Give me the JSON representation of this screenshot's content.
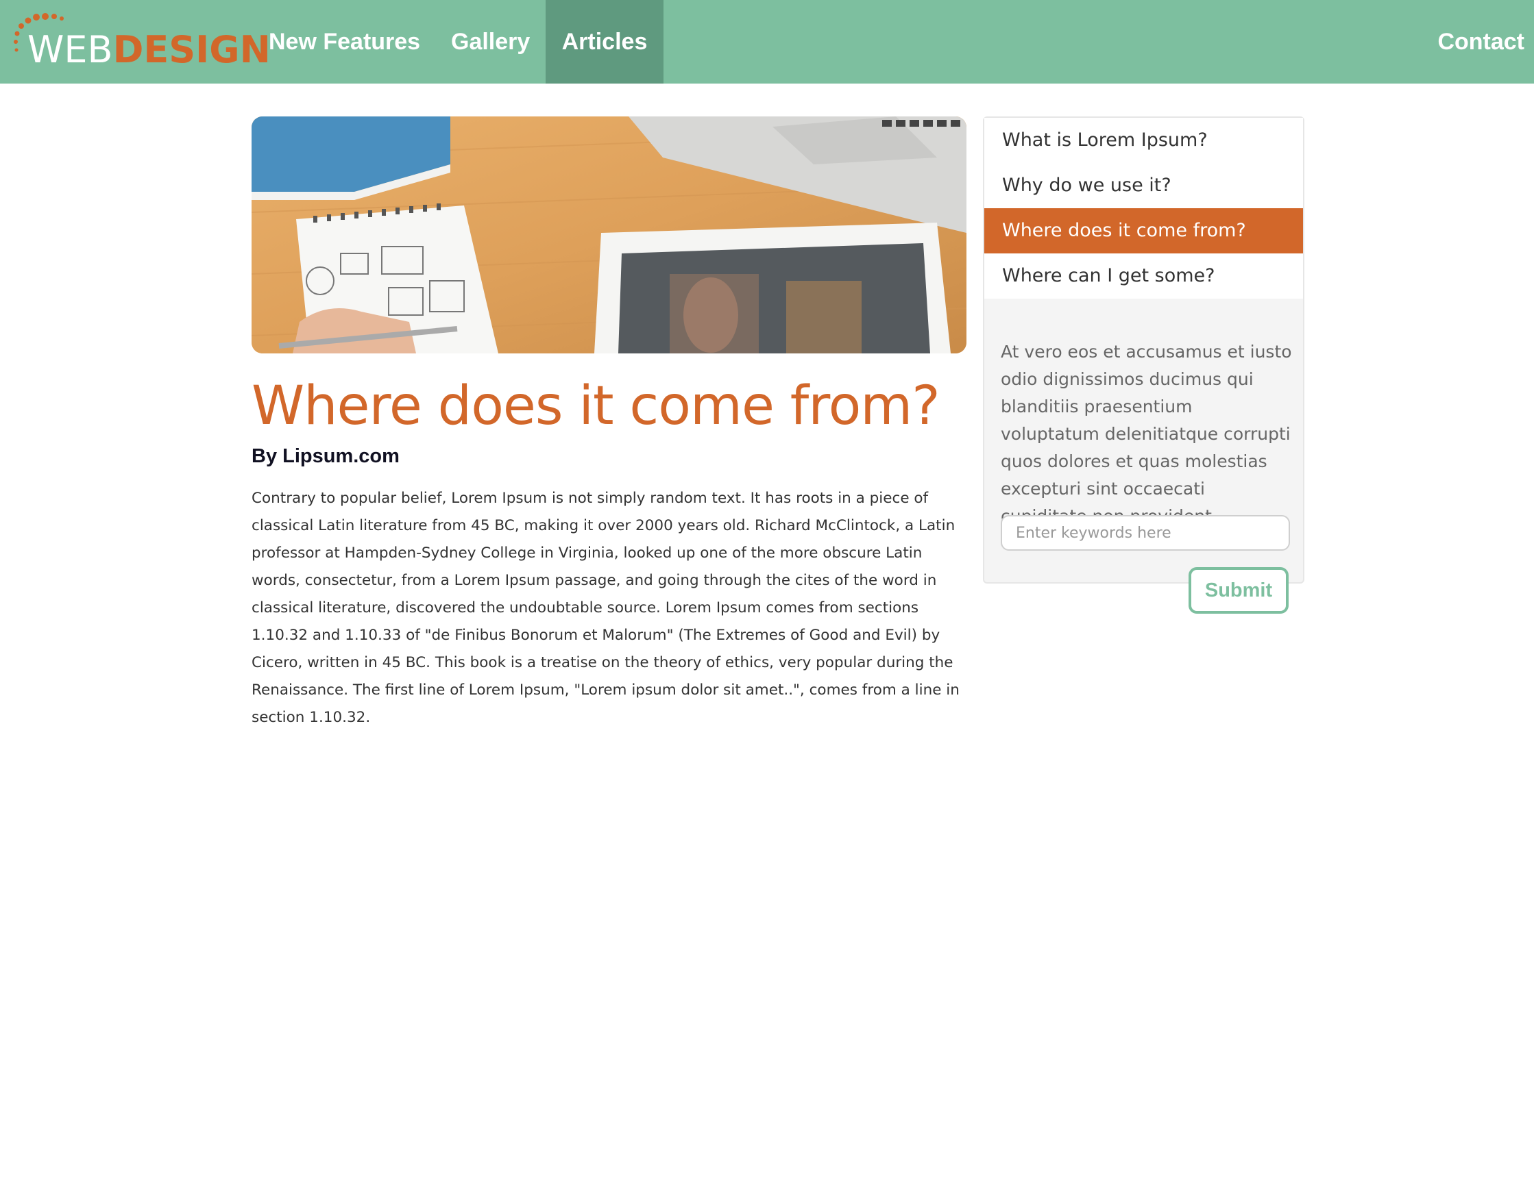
{
  "brand": {
    "web": "WEB",
    "design": "DESIGN"
  },
  "nav": {
    "new_features": "New Features",
    "gallery": "Gallery",
    "articles": "Articles",
    "contact": "Contact"
  },
  "colors": {
    "green": "#7dbf9f",
    "green_dark": "#5f9a7f",
    "orange": "#d2672a"
  },
  "article": {
    "title": "Where does it come from?",
    "author": "By Lipsum.com",
    "body": "Contrary to popular belief, Lorem Ipsum is not simply random text. It has roots in a piece of classical Latin literature from 45 BC, making it over 2000 years old. Richard McClintock, a Latin professor at Hampden-Sydney College in Virginia, looked up one of the more obscure Latin words, consectetur, from a Lorem Ipsum passage, and going through the cites of the word in classical literature, discovered the undoubtable source. Lorem Ipsum comes from sections 1.10.32 and 1.10.33 of \"de Finibus Bonorum et Malorum\" (The Extremes of Good and Evil) by Cicero, written in 45 BC. This book is a treatise on the theory of ethics, very popular during the Renaissance. The first line of Lorem Ipsum, \"Lorem ipsum dolor sit amet..\", comes from a line in section 1.10.32."
  },
  "sidebar": {
    "items": [
      {
        "label": "What is Lorem Ipsum?"
      },
      {
        "label": "Why do we use it?"
      },
      {
        "label": "Where does it come from?"
      },
      {
        "label": "Where can I get some?"
      }
    ],
    "text": "At vero eos et accusamus et iusto odio dignissimos ducimus qui blanditiis praesentium voluptatum delenitiatque corrupti quos dolores et quas molestias excepturi sint occaecati cupiditate non provident,",
    "search_placeholder": "Enter keywords here",
    "search_value": "",
    "submit_label": "Submit"
  }
}
